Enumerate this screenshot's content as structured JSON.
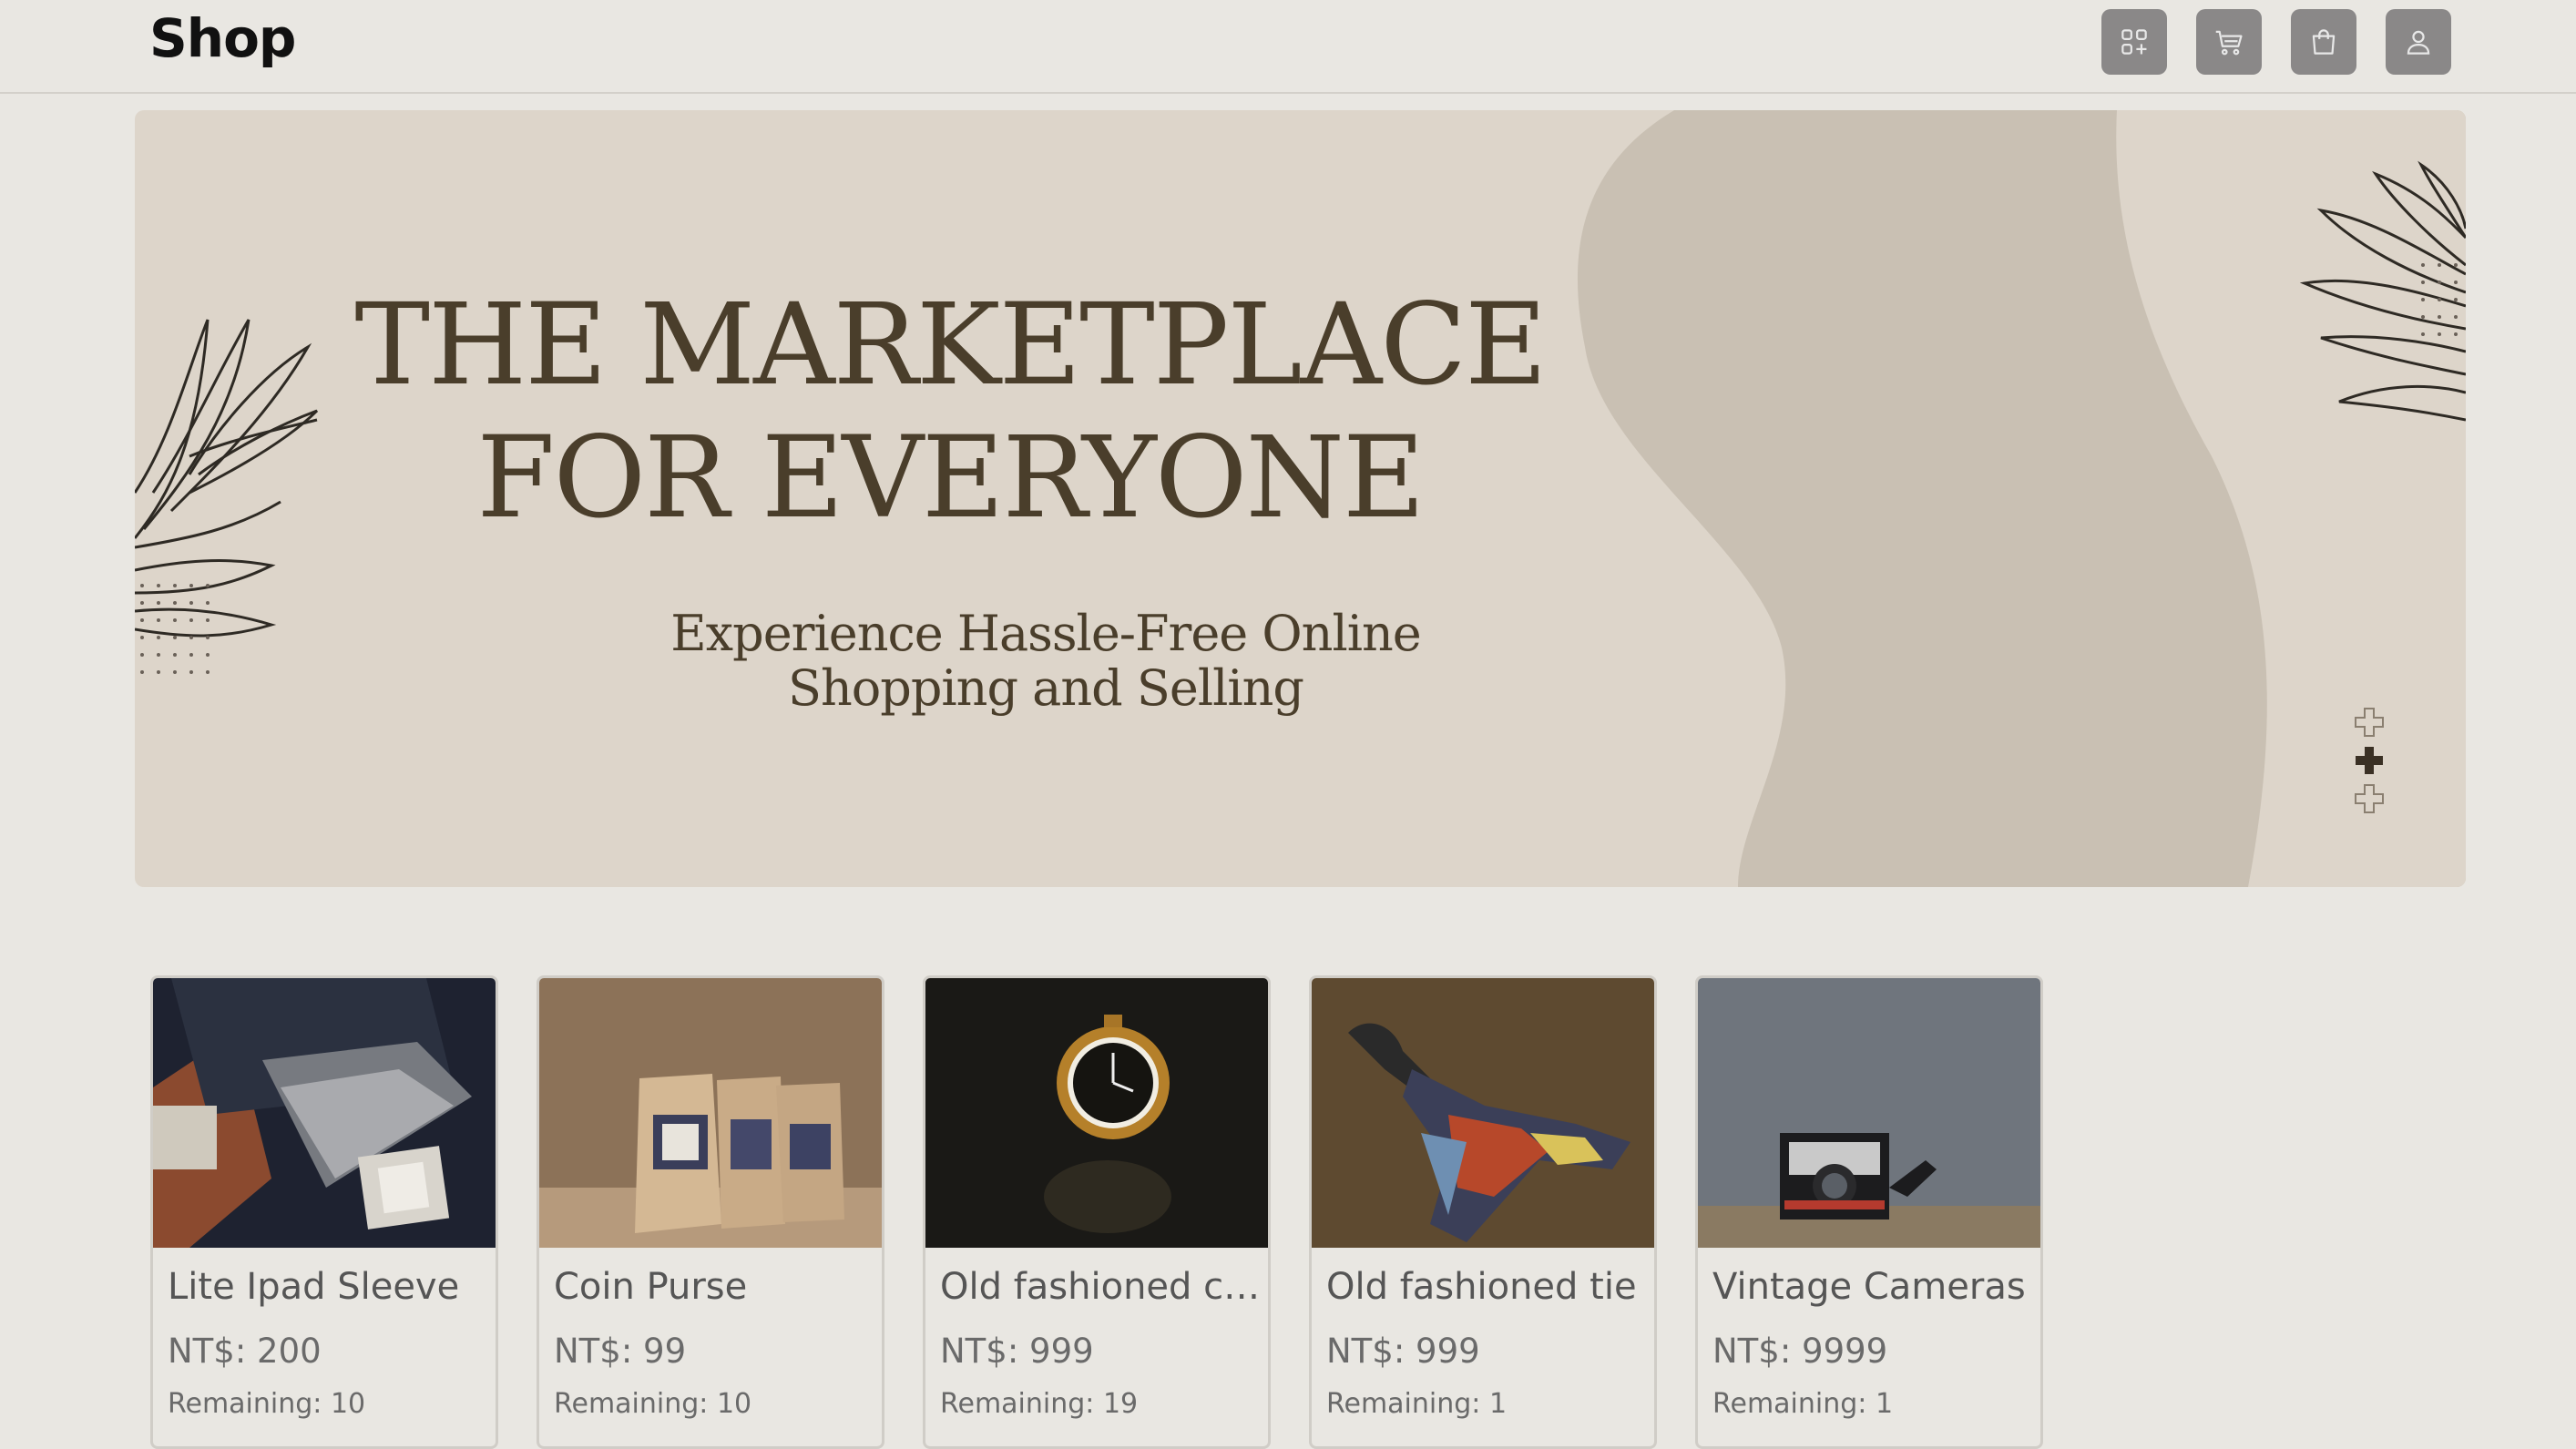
{
  "header": {
    "logo": "Shop",
    "nav_icons": [
      "dashboard-icon",
      "cart-icon",
      "shopping-bag-icon",
      "user-icon"
    ],
    "button_color": "#8a8888"
  },
  "hero": {
    "title_line1": "THE MARKETPLACE",
    "title_line2": "FOR EVERYONE",
    "subtitle_line1": "Experience Hassle-Free Online",
    "subtitle_line2": "Shopping and Selling",
    "colors": {
      "background": "#ddd5ca",
      "blob": "#c9c0b3",
      "text": "#4a3e2b"
    }
  },
  "products": [
    {
      "name": "Lite Ipad Sleeve",
      "price": "NT$: 200",
      "remaining": "Remaining: 10"
    },
    {
      "name": "Coin Purse",
      "price": "NT$: 99",
      "remaining": "Remaining: 10"
    },
    {
      "name": "Old fashioned cl...",
      "price": "NT$: 999",
      "remaining": "Remaining: 19"
    },
    {
      "name": "Old fashioned tie",
      "price": "NT$: 999",
      "remaining": "Remaining: 1"
    },
    {
      "name": "Vintage Cameras",
      "price": "NT$: 9999",
      "remaining": "Remaining: 1"
    }
  ]
}
